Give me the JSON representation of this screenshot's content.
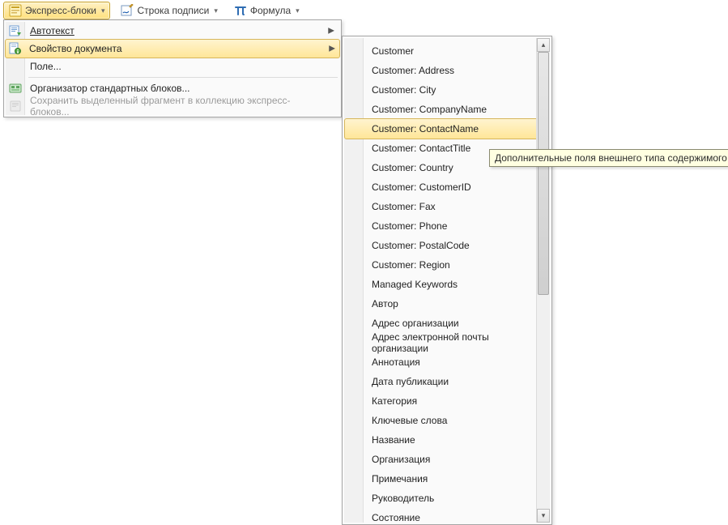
{
  "ribbon": {
    "express_blocks": "Экспресс-блоки",
    "signature_line": "Строка подписи",
    "formula": "Формула"
  },
  "menu": {
    "autotext": "Автотекст",
    "doc_property": "Свойство документа",
    "field": "Поле...",
    "organizer": "Организатор стандартных блоков...",
    "save_selection": "Сохранить выделенный фрагмент в коллекцию экспресс-блоков..."
  },
  "submenu": {
    "items": [
      "Customer",
      "Customer: Address",
      "Customer: City",
      "Customer: CompanyName",
      "Customer: ContactName",
      "Customer: ContactTitle",
      "Customer: Country",
      "Customer: CustomerID",
      "Customer: Fax",
      "Customer: Phone",
      "Customer: PostalCode",
      "Customer: Region",
      "Managed Keywords",
      "Автор",
      "Адрес организации",
      "Адрес электронной почты организации",
      "Аннотация",
      "Дата публикации",
      "Категория",
      "Ключевые слова",
      "Название",
      "Организация",
      "Примечания",
      "Руководитель",
      "Состояние"
    ],
    "highlight_index": 4
  },
  "tooltip": "Дополнительные поля внешнего типа содержимого"
}
